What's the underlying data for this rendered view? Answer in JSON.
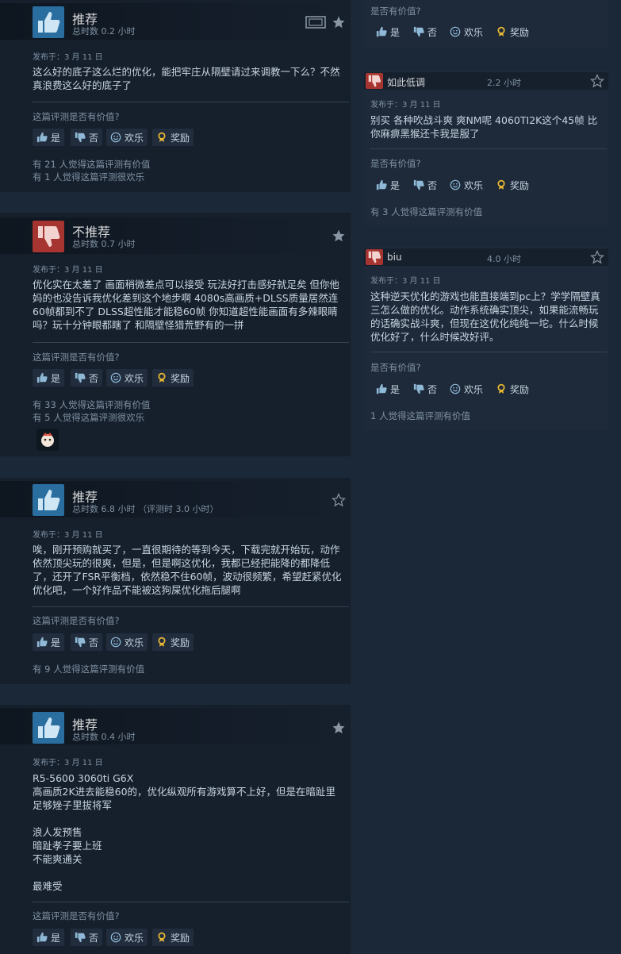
{
  "common": {
    "ask": "这篇评测是否有价值?",
    "ask_short": "是否有价值?",
    "yes": "是",
    "no": "否",
    "funny": "欢乐",
    "award": "奖励"
  },
  "reviews": [
    {
      "title": "推荐",
      "hours": "总时数 0.2 小时",
      "posted": "发布于：3 月 11 日",
      "body": "这么好的底子这么烂的优化，能把牢庄从隔壁请过来调教一下么？不然真浪费这么好的底子了",
      "stat1": "有 21 人觉得这篇评测有价值",
      "stat2": "有 1 人觉得这篇评测很欢乐"
    },
    {
      "title": "不推荐",
      "hours": "总时数 0.7 小时",
      "posted": "发布于：3 月 11 日",
      "body": "优化实在太差了 画面稍微差点可以接受 玩法好打击感好就足矣 但你他妈的也没告诉我优化差到这个地步啊 4080s高画质+DLSS质量居然连60帧都到不了 DLSS超性能才能稳60帧 你知道超性能画面有多辣眼睛吗？玩十分钟眼都瞎了 和隔壁怪猎荒野有的一拼",
      "stat1": "有 33 人觉得这篇评测有价值",
      "stat2": "有 5 人觉得这篇评测很欢乐"
    },
    {
      "title": "推荐",
      "hours": "总时数 6.8 小时 （评测时 3.0 小时）",
      "posted": "发布于：3 月 11 日",
      "body": "唉，刚开预购就买了，一直很期待的等到今天，下载完就开始玩，动作依然顶尖玩的很爽，但是，但是啊这优化，我都已经把能降的都降低了，还开了FSR平衡档，依然稳不住60帧，波动很频繁，希望赶紧优化优化吧，一个好作品不能被这狗屎优化拖后腿啊",
      "stat1": "有 9 人觉得这篇评测有价值"
    },
    {
      "title": "推荐",
      "hours": "总时数 0.4 小时",
      "posted": "发布于：3 月 11 日",
      "body": "R5-5600 3060ti G6X\n高画质2K进去能稳60的，优化纵观所有游戏算不上好，但是在暗趾里足够矬子里拔将军\n\n浪人发预售\n暗趾孝子要上班\n不能爽通关\n\n最难受"
    }
  ],
  "responses": [
    {
      "name": "如此低调",
      "hours": "2.2 小时",
      "posted": "发布于：3 月 11 日",
      "body": "别买 各种吹战斗爽 爽NM呢 4060TI2K这个45帧 比你麻痹黑猴还卡我是服了",
      "stat": "有 3 人觉得这篇评测有价值"
    },
    {
      "name": "biu",
      "hours": "4.0 小时",
      "posted": "发布于：3 月 11 日",
      "body": "这种逆天优化的游戏也能直接端到pc上？学学隔壁真三怎么做的优化。动作系统确实顶尖，如果能流畅玩的话确实战斗爽，但现在这优化纯纯一坨。什么时候优化好了，什么时候改好评。",
      "stat": "1 人觉得这篇评测有价值"
    }
  ],
  "colors": {
    "bg": "#1b2838",
    "card": "#16202d",
    "up": "#2a6ea0",
    "down": "#a63430",
    "award": "#e8b832"
  }
}
